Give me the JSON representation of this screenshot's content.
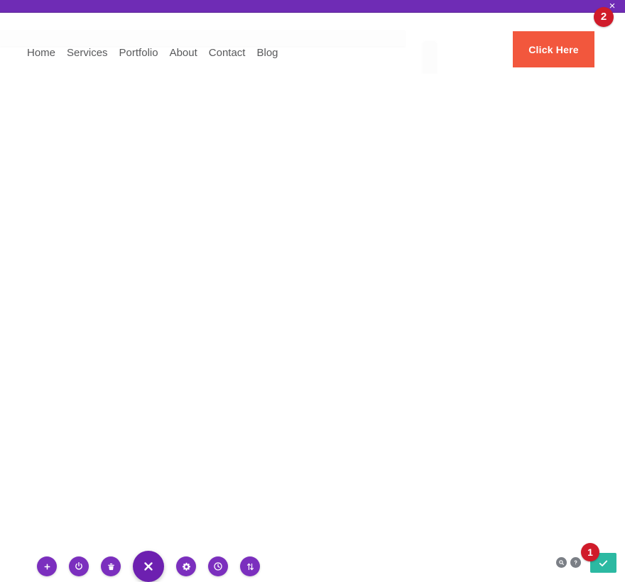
{
  "window": {
    "top_bar_color": "#6f2cb5",
    "close_label": "×"
  },
  "badges": {
    "header_badge": "2",
    "footer_badge": "1",
    "badge_color": "#d01b2a"
  },
  "nav": {
    "items": [
      {
        "label": "Home"
      },
      {
        "label": "Services"
      },
      {
        "label": "Portfolio"
      },
      {
        "label": "About"
      },
      {
        "label": "Contact"
      },
      {
        "label": "Blog"
      }
    ]
  },
  "cta": {
    "label": "Click Here",
    "color": "#f2573d"
  },
  "toolbar": {
    "accent_color": "#7b2fbe",
    "main_color": "#6d20b0",
    "buttons": [
      {
        "name": "add-icon",
        "title": "Add"
      },
      {
        "name": "power-icon",
        "title": "Power"
      },
      {
        "name": "trash-icon",
        "title": "Delete"
      },
      {
        "name": "close-x-icon",
        "title": "Close"
      },
      {
        "name": "gear-icon",
        "title": "Settings"
      },
      {
        "name": "clock-icon",
        "title": "History"
      },
      {
        "name": "sort-arrows-icon",
        "title": "Sort"
      }
    ]
  },
  "footer": {
    "search_title": "Search",
    "help_title": "Help",
    "confirm_title": "Confirm",
    "confirm_color": "#2cb9a2"
  }
}
